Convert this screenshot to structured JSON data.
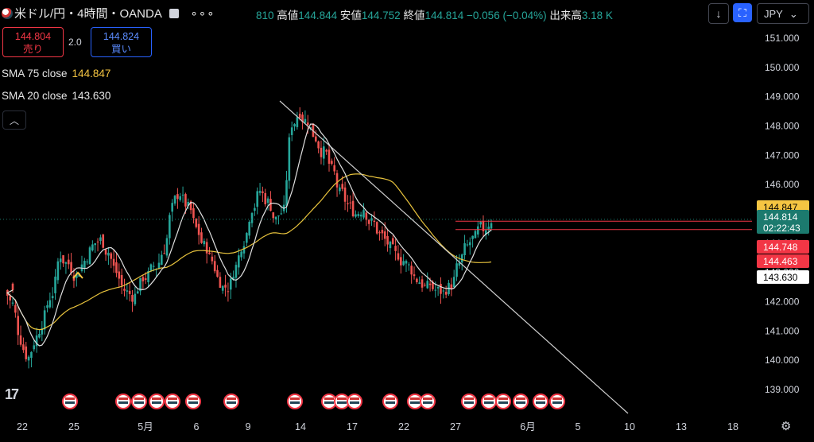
{
  "header": {
    "symbol": "米ドル/円・4時間・OANDA",
    "ohlc_partial": "810",
    "high_label": "高値",
    "high": "144.844",
    "low_label": "安値",
    "low": "144.752",
    "close_label": "終値",
    "close": "144.814",
    "change": "−0.056 (−0.04%)",
    "volume_label": "出来高",
    "volume": "3.18 K"
  },
  "toolbar": {
    "currency": "JPY",
    "more_icon": "dots-icon"
  },
  "trade": {
    "sell_price": "144.804",
    "sell_label": "売り",
    "spread": "2.0",
    "buy_price": "144.824",
    "buy_label": "買い"
  },
  "indicators": [
    {
      "name": "SMA 75 close",
      "value": "144.847",
      "color": "#f5c542"
    },
    {
      "name": "SMA 20 close",
      "value": "143.630",
      "color": "#e6e6e6"
    }
  ],
  "colors": {
    "up": "#26a69a",
    "down": "#ef5350",
    "sma75": "#e8c33d",
    "sma20": "#e0e0e0",
    "trendline": "#cfcfcf",
    "bg": "#000000"
  },
  "chart_data": {
    "type": "candlestick",
    "symbol": "米ドル/円",
    "timeframe": "4時間",
    "ylim": [
      138.5,
      151.5
    ],
    "y_ticks": [
      "151.000",
      "150.000",
      "149.000",
      "148.000",
      "147.000",
      "146.000",
      "145.000",
      "144.000",
      "143.000",
      "142.000",
      "141.000",
      "140.000",
      "139.000"
    ],
    "x_ticks": [
      {
        "label": "22"
      },
      {
        "label": "25"
      },
      {
        "label": "5月"
      },
      {
        "label": "6"
      },
      {
        "label": "9"
      },
      {
        "label": "14"
      },
      {
        "label": "17"
      },
      {
        "label": "22"
      },
      {
        "label": "27"
      },
      {
        "label": "6月"
      },
      {
        "label": "5"
      },
      {
        "label": "10"
      },
      {
        "label": "13"
      },
      {
        "label": "18"
      }
    ],
    "price_labels": [
      {
        "text": "144.847",
        "price": 144.847,
        "bg": "#f5c542",
        "fg": "#000000"
      },
      {
        "text": "144.814",
        "sub": "02:22:43",
        "price": 144.814,
        "bg": "#1c7a6e",
        "fg": "#ffffff"
      },
      {
        "text": "144.748",
        "price": 144.748,
        "bg": "#f23645",
        "fg": "#ffffff"
      },
      {
        "text": "144.463",
        "price": 144.463,
        "bg": "#f23645",
        "fg": "#ffffff"
      },
      {
        "text": "143.630",
        "price": 143.63,
        "bg": "#ffffff",
        "fg": "#000000"
      }
    ],
    "series": [
      {
        "name": "SMA 75 close",
        "last": 144.847
      },
      {
        "name": "SMA 20 close",
        "last": 143.63
      }
    ],
    "close_path": [
      142.4,
      141.9,
      140.7,
      140.1,
      140.8,
      141.5,
      142.3,
      143.6,
      143.3,
      142.9,
      143.4,
      143.9,
      144.1,
      143.7,
      143.0,
      142.4,
      142.2,
      142.6,
      142.9,
      143.2,
      143.8,
      145.2,
      145.7,
      145.2,
      144.5,
      143.9,
      143.4,
      142.7,
      142.5,
      143.2,
      144.1,
      145.2,
      145.8,
      145.4,
      144.8,
      145.1,
      148.1,
      148.5,
      148.2,
      147.6,
      147.1,
      146.5,
      145.7,
      145.3,
      145.0,
      145.2,
      144.7,
      144.3,
      144.0,
      143.6,
      143.4,
      143.1,
      142.7,
      142.5,
      142.4,
      142.3,
      142.6,
      143.3,
      143.9,
      144.2,
      144.5,
      144.8
    ]
  }
}
